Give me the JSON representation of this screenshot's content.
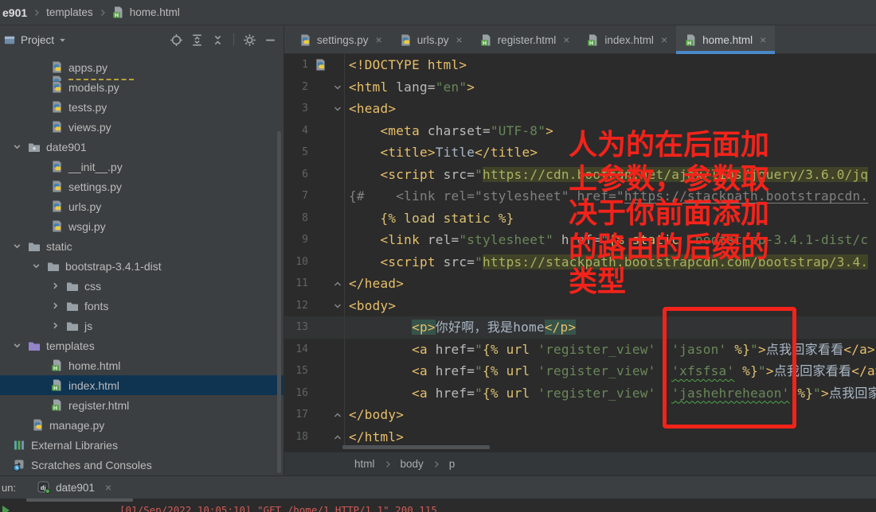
{
  "window_breadcrumb": {
    "items": [
      "e901",
      "templates",
      "home.html"
    ]
  },
  "project_panel": {
    "title": "Project",
    "toolbar_icons": [
      "locate",
      "expand-all",
      "collapse-all",
      "settings",
      "hide"
    ],
    "tree": [
      {
        "label": "apps.py",
        "type": "py",
        "indent": 64
      },
      {
        "label": "models.py",
        "type": "py",
        "indent": 64
      },
      {
        "label": "tests.py",
        "type": "py",
        "indent": 64
      },
      {
        "label": "views.py",
        "type": "py",
        "indent": 64
      },
      {
        "label": "date901",
        "type": "folder-pkg",
        "indent": 16,
        "chevron": "down"
      },
      {
        "label": "__init__.py",
        "type": "py",
        "indent": 64
      },
      {
        "label": "settings.py",
        "type": "py",
        "indent": 64
      },
      {
        "label": "urls.py",
        "type": "py",
        "indent": 64
      },
      {
        "label": "wsgi.py",
        "type": "py",
        "indent": 64
      },
      {
        "label": "static",
        "type": "folder",
        "indent": 16,
        "chevron": "down"
      },
      {
        "label": "bootstrap-3.4.1-dist",
        "type": "folder",
        "indent": 40,
        "chevron": "down"
      },
      {
        "label": "css",
        "type": "folder",
        "indent": 64,
        "chevron": "right"
      },
      {
        "label": "fonts",
        "type": "folder",
        "indent": 64,
        "chevron": "right"
      },
      {
        "label": "js",
        "type": "folder",
        "indent": 64,
        "chevron": "right"
      },
      {
        "label": "templates",
        "type": "folder-templates",
        "indent": 16,
        "chevron": "down"
      },
      {
        "label": "home.html",
        "type": "html",
        "indent": 64
      },
      {
        "label": "index.html",
        "type": "html",
        "indent": 64,
        "selected": true
      },
      {
        "label": "register.html",
        "type": "html",
        "indent": 64
      },
      {
        "label": "manage.py",
        "type": "py",
        "indent": 40
      },
      {
        "label": "External Libraries",
        "type": "lib",
        "indent": 16
      },
      {
        "label": "Scratches and Consoles",
        "type": "scratch",
        "indent": 16
      }
    ]
  },
  "editor": {
    "tab_close": "×",
    "tabs": [
      {
        "label": "settings.py",
        "icon": "py",
        "active": false
      },
      {
        "label": "urls.py",
        "icon": "py",
        "active": false
      },
      {
        "label": "register.html",
        "icon": "html",
        "active": false
      },
      {
        "label": "index.html",
        "icon": "html",
        "active": false
      },
      {
        "label": "home.html",
        "icon": "html",
        "active": true
      }
    ],
    "breadcrumb": [
      "html",
      "body",
      "p"
    ],
    "colors": {
      "tag": "#e8bf6a",
      "attribute": "#bababa",
      "string": "#6a8759",
      "accent_tab_underline": "#4a88c7",
      "selection_row": "#0f3452",
      "current_line": "#323334",
      "injected_string_bg": "#404328",
      "matched_tag_bg": "#37544a"
    },
    "code_lines": [
      {
        "n": 1,
        "gutter": "py",
        "seg": [
          [
            "t",
            "<!DOCTYPE html>"
          ]
        ]
      },
      {
        "n": 2,
        "fold": "down",
        "seg": [
          [
            "t",
            "<html "
          ],
          [
            "a",
            "lang="
          ],
          [
            "s",
            "\"en\""
          ],
          [
            "t",
            ">"
          ]
        ]
      },
      {
        "n": 3,
        "fold": "down",
        "seg": [
          [
            "t",
            "<head>"
          ]
        ]
      },
      {
        "n": 4,
        "seg": [
          [
            "w",
            "    "
          ],
          [
            "t",
            "<meta "
          ],
          [
            "a",
            "charset="
          ],
          [
            "s",
            "\"UTF-8\""
          ],
          [
            "t",
            ">"
          ]
        ]
      },
      {
        "n": 5,
        "seg": [
          [
            "w",
            "    "
          ],
          [
            "t",
            "<title>"
          ],
          [
            "w",
            "Title"
          ],
          [
            "t",
            "</title>"
          ]
        ]
      },
      {
        "n": 6,
        "seg": [
          [
            "w",
            "    "
          ],
          [
            "t",
            "<script "
          ],
          [
            "a",
            "src="
          ],
          [
            "s",
            "\""
          ],
          [
            "hs",
            "https://cdn.bootcdn.net/ajax/libs/jquery/3.6.0/jq"
          ]
        ]
      },
      {
        "n": 7,
        "seg": [
          [
            "c",
            "{#    <link rel=\"stylesheet\" href=\""
          ],
          [
            "cu",
            "https://stackpath.bootstrapcdn."
          ]
        ]
      },
      {
        "n": 8,
        "seg": [
          [
            "w",
            "    "
          ],
          [
            "d",
            "{% load static %}"
          ]
        ]
      },
      {
        "n": 9,
        "seg": [
          [
            "w",
            "    "
          ],
          [
            "t",
            "<link "
          ],
          [
            "a",
            "rel="
          ],
          [
            "s",
            "\"stylesheet\""
          ],
          [
            "a",
            " href="
          ],
          [
            "s",
            "\""
          ],
          [
            "d",
            "{% static "
          ],
          [
            "s",
            "'bootstrap-3.4.1-dist/c"
          ]
        ]
      },
      {
        "n": 10,
        "seg": [
          [
            "w",
            "    "
          ],
          [
            "t",
            "<script "
          ],
          [
            "a",
            "src="
          ],
          [
            "s",
            "\""
          ],
          [
            "hs",
            "https://stackpath.bootstrapcdn.com/bootstrap/3.4."
          ]
        ]
      },
      {
        "n": 11,
        "fold": "up",
        "seg": [
          [
            "t",
            "</head>"
          ]
        ]
      },
      {
        "n": 12,
        "fold": "down",
        "seg": [
          [
            "t",
            "<body>"
          ]
        ]
      },
      {
        "n": 13,
        "cur": true,
        "seg": [
          [
            "w",
            "        "
          ],
          [
            "tm",
            "<p>"
          ],
          [
            "w",
            "你好啊，我是home"
          ],
          [
            "tm",
            "</p>"
          ]
        ]
      },
      {
        "n": 14,
        "seg": [
          [
            "w",
            "        "
          ],
          [
            "t",
            "<a "
          ],
          [
            "a",
            "href="
          ],
          [
            "s",
            "\""
          ],
          [
            "d",
            "{% url "
          ],
          [
            "s",
            "'register_view'"
          ],
          [
            "w",
            "  "
          ],
          [
            "s",
            "'jason'"
          ],
          [
            "d",
            " %}"
          ],
          [
            "s",
            "\""
          ],
          [
            "t",
            ">"
          ],
          [
            "w",
            "点我回家看看"
          ],
          [
            "t",
            "</a>"
          ]
        ]
      },
      {
        "n": 15,
        "seg": [
          [
            "w",
            "        "
          ],
          [
            "t",
            "<a "
          ],
          [
            "a",
            "href="
          ],
          [
            "s",
            "\""
          ],
          [
            "d",
            "{% url "
          ],
          [
            "s",
            "'register_view'"
          ],
          [
            "w",
            "  "
          ],
          [
            "su",
            "'xfsfsa'"
          ],
          [
            "d",
            " %}"
          ],
          [
            "s",
            "\""
          ],
          [
            "t",
            ">"
          ],
          [
            "w",
            "点我回家看看"
          ],
          [
            "t",
            "</a>"
          ]
        ]
      },
      {
        "n": 16,
        "seg": [
          [
            "w",
            "        "
          ],
          [
            "t",
            "<a "
          ],
          [
            "a",
            "href="
          ],
          [
            "s",
            "\""
          ],
          [
            "d",
            "{% url "
          ],
          [
            "s",
            "'register_view'"
          ],
          [
            "w",
            "  "
          ],
          [
            "su",
            "'jashehreheaon'"
          ],
          [
            "d",
            " %}"
          ],
          [
            "s",
            "\""
          ],
          [
            "t",
            ">"
          ],
          [
            "w",
            "点我回家看看"
          ],
          [
            "t",
            "</a>"
          ]
        ]
      },
      {
        "n": 17,
        "fold": "up",
        "seg": [
          [
            "t",
            "</body>"
          ]
        ]
      },
      {
        "n": 18,
        "fold": "up",
        "seg": [
          [
            "t",
            "</html>"
          ]
        ]
      }
    ]
  },
  "annotation": {
    "color": "#f2231a",
    "note_lines": [
      "人为的在后面加",
      "上参数，参数取",
      "决于你前面添加",
      "的路由的后缀的",
      "类型"
    ]
  },
  "run_panel": {
    "prefix": "un:",
    "tab_label": "date901",
    "close": "×",
    "console_line": "[01/Sep/2022 10:05:10] \"GET /home/1 HTTP/1.1\" 200 115"
  },
  "icon_names": {
    "py": "python-file-icon",
    "html": "html-file-icon",
    "folder": "folder-icon",
    "folder-pkg": "package-folder-icon",
    "folder-templates": "templates-folder-icon",
    "lib": "external-libraries-icon",
    "scratch": "scratches-and-consoles-icon",
    "dj": "django-run-icon",
    "locate": "locate-icon",
    "expand-all": "expand-all-icon",
    "collapse-all": "collapse-all-icon",
    "settings": "gear-icon",
    "hide": "minimize-icon"
  }
}
